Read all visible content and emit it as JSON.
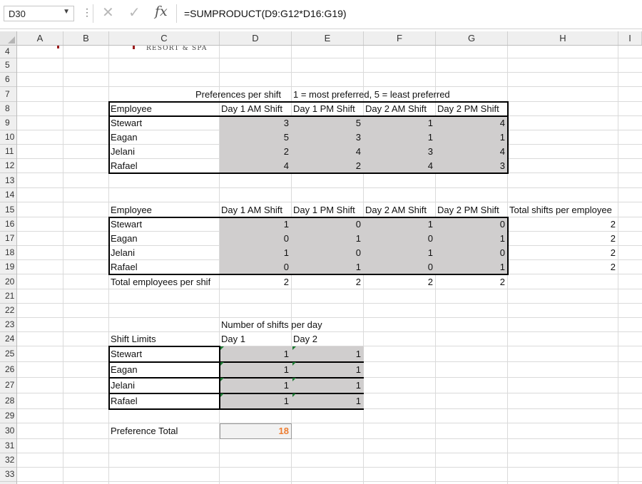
{
  "formula_bar": {
    "name_box": "D30",
    "cancel_glyph": "✕",
    "enter_glyph": "✓",
    "fx_label": "fx",
    "formula": "=SUMPRODUCT(D9:G12*D16:G19)"
  },
  "columns": [
    "A",
    "B",
    "C",
    "D",
    "E",
    "F",
    "G",
    "H",
    "I"
  ],
  "rows": [
    "4",
    "5",
    "6",
    "7",
    "8",
    "9",
    "10",
    "11",
    "12",
    "13",
    "14",
    "15",
    "16",
    "17",
    "18",
    "19",
    "20",
    "21",
    "22",
    "23",
    "24",
    "25",
    "26",
    "27",
    "28",
    "29",
    "30",
    "31",
    "32",
    "33"
  ],
  "logo_text": "RESORT & SPA",
  "preferences": {
    "title": "Preferences per shift",
    "legend": "1 = most preferred, 5 = least preferred",
    "header": [
      "Employee",
      "Day 1 AM Shift",
      "Day 1 PM Shift",
      "Day 2 AM Shift",
      "Day 2 PM Shift"
    ],
    "rows": [
      {
        "name": "Stewart",
        "vals": [
          "3",
          "5",
          "1",
          "4"
        ]
      },
      {
        "name": "Eagan",
        "vals": [
          "5",
          "3",
          "1",
          "1"
        ]
      },
      {
        "name": "Jelani",
        "vals": [
          "2",
          "4",
          "3",
          "4"
        ]
      },
      {
        "name": "Rafael",
        "vals": [
          "4",
          "2",
          "4",
          "3"
        ]
      }
    ]
  },
  "assignments": {
    "header": [
      "Employee",
      "Day 1 AM Shift",
      "Day 1 PM Shift",
      "Day 2 AM Shift",
      "Day 2 PM Shift",
      "Total shifts per employee"
    ],
    "rows": [
      {
        "name": "Stewart",
        "vals": [
          "1",
          "0",
          "1",
          "0"
        ],
        "total": "2"
      },
      {
        "name": "Eagan",
        "vals": [
          "0",
          "1",
          "0",
          "1"
        ],
        "total": "2"
      },
      {
        "name": "Jelani",
        "vals": [
          "1",
          "0",
          "1",
          "0"
        ],
        "total": "2"
      },
      {
        "name": "Rafael",
        "vals": [
          "0",
          "1",
          "0",
          "1"
        ],
        "total": "2"
      }
    ],
    "totals_label": "Total employees per shif",
    "totals": [
      "2",
      "2",
      "2",
      "2"
    ]
  },
  "shift_limits": {
    "group_label": "Number of shifts per day",
    "label": "Shift Limits",
    "header": [
      "Day 1",
      "Day 2"
    ],
    "rows": [
      {
        "name": "Stewart",
        "vals": [
          "1",
          "1"
        ]
      },
      {
        "name": "Eagan",
        "vals": [
          "1",
          "1"
        ]
      },
      {
        "name": "Jelani",
        "vals": [
          "1",
          "1"
        ]
      },
      {
        "name": "Rafael",
        "vals": [
          "1",
          "1"
        ]
      }
    ]
  },
  "preference_total": {
    "label": "Preference Total",
    "value": "18",
    "value_color": "#ed7d31"
  }
}
